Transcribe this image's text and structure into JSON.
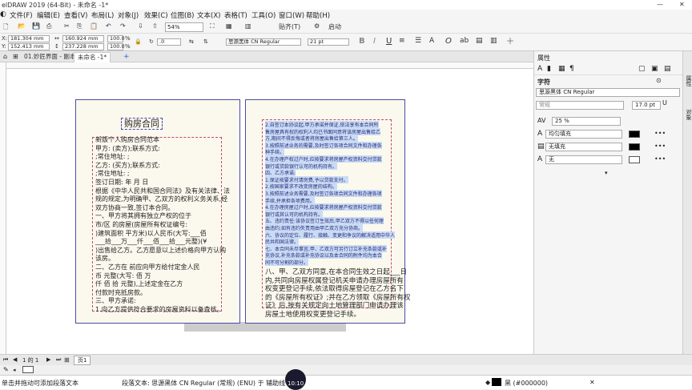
{
  "title": "elDRAW 2019 (64-Bit) - 未命名 -1*",
  "menu": [
    "文件(F)",
    "编辑(E)",
    "查看(V)",
    "布局(L)",
    "对象(J)",
    "效果(C)",
    "位图(B)",
    "文本(X)",
    "表格(T)",
    "工具(O)",
    "窗口(W)",
    "帮助(H)"
  ],
  "toolbar": {
    "zoom": "54%",
    "paste_label": "贴齐(T)",
    "launch_label": "启动"
  },
  "propbar": {
    "x": "181.304 mm",
    "y": "152.413 mm",
    "w": "160.924 mm",
    "h": "237.228 mm",
    "sx": "100.0",
    "sy": "100.0",
    "pct": "%",
    "angle": ".0",
    "font": "思源黑体 CN Regular",
    "size": "21 pt"
  },
  "tabs": {
    "welcome": "01.妙匠界面 - 副本.cdr*",
    "doc": "未命名 -1*",
    "add": "+"
  },
  "page_left": {
    "title": "购房合同",
    "lines": [
      "新版个人购房合同范本",
      "甲方:              (卖方);联系方式:",
      ";常住地址:                         ;",
      "乙方:              (买方);联系方式:",
      ";常住地址:                         ;",
      "签订日期:        年       月       日",
      "根据《中华人民共和国合同法》及有关法律、法",
      "规的规定,为明确甲、乙双方的权利义务关系,经",
      "双方协商一致,签订本合同。",
      "一、甲方将其拥有独立产权的位于",
      "市/区          的房屋(房屋所有权证编号:",
      ")建筑面积       平方米)以人民币(大写:___佰",
      "___拾___万___仟___佰___拾___元整)(¥",
      ")出售给乙方。乙方愿意以上述价格向甲方认购",
      "该房。",
      "二、乙方在           前应向甲方给付定金人民",
      "币            元整(大写:    佰       万",
      "仟       佰       拾       元整),上述定金在乙方",
      "付款时充抵房款。",
      "三、甲方承诺:",
      "1.向乙方提供符合要求的房屋资料以备查核。"
    ]
  },
  "page_right": {
    "hl_lines": [
      "2.自签订本协议起,甲方承诺并保证,依法享有本合同所",
      "售房屋具有权的权利人均已书面同意将该房屋出售给乙",
      "方,期间不得反悔或者将房屋出售给第三人。",
      "3.按照前述业务的需要,及时签订各项合同文件和办理各",
      "种手续。",
      "4.在办理产权过户时,应按要求将房屋产权资料交付贷款",
      "银行或贷款银行认可的机构持有。",
      "四、乙方承诺:",
      "1.保证按要求付清房费,予以贷款支付。",
      "2.按国家要求不改变房屋的结构。",
      "3.按照前述业务需要,及时签订各项合同文件和办理各项",
      "手续,并承担各项费用。",
      "4.在办理房屋过户时,应按要求将房屋产权资料交付贷款",
      "银行或其认可的机构持有。",
      "五、违约责任:该协议签订生效后,甲乙双方不得以任何理",
      "由违约;如有违约失责用由甲乙双方充分协商。",
      "六、协议的定位、履行、接触、变更和争议的解决适用中华人",
      "民共和国法律。",
      "七、本合同未尽事宜,甲、乙双方可另行订立补充条款或补",
      "充协议,补充条款或补充协议以及本合同的附件均为本合",
      "同不可分割的部分。"
    ],
    "lines": [
      "八、甲、乙双方同意,在本合同生效之日起___日",
      "内,共同向房屋权属登记机关申请办理房屋所有",
      "权变更登记手续,依法取得房屋登记在乙方名下",
      "的《房屋所有权证》;并在乙方领取《房屋所有权",
      "证》后,按有关规定向土地管理部门申请办理该",
      "房屋土地使用权变更登记手续。"
    ]
  },
  "rightpanel": {
    "header": "属性",
    "section": "字符",
    "font": "思源黑体 CN Regular",
    "style": "常规",
    "size": "17.0 pt",
    "tracking": "25 %",
    "fill_label": "均匀填充",
    "bg_label": "无填充",
    "outline_label": "无"
  },
  "sidetabs": {
    "props": "属性",
    "objects": "对象"
  },
  "bottombar": {
    "page_label": "页1",
    "page_count": "1 的 1"
  },
  "status": {
    "hint": "单击并拖动可添加段落文本",
    "text_info": "段落文本: 思源黑体 CN Regular (常规) (ENU) 于 辅助线",
    "time": "10:10",
    "fill_color": "黑 (#000000)"
  },
  "colors": {
    "accent": "#1e6fd9",
    "page_bg": "#fbf9ee",
    "frame": "#4a4aa8",
    "highlight": "#c9dcf5"
  }
}
